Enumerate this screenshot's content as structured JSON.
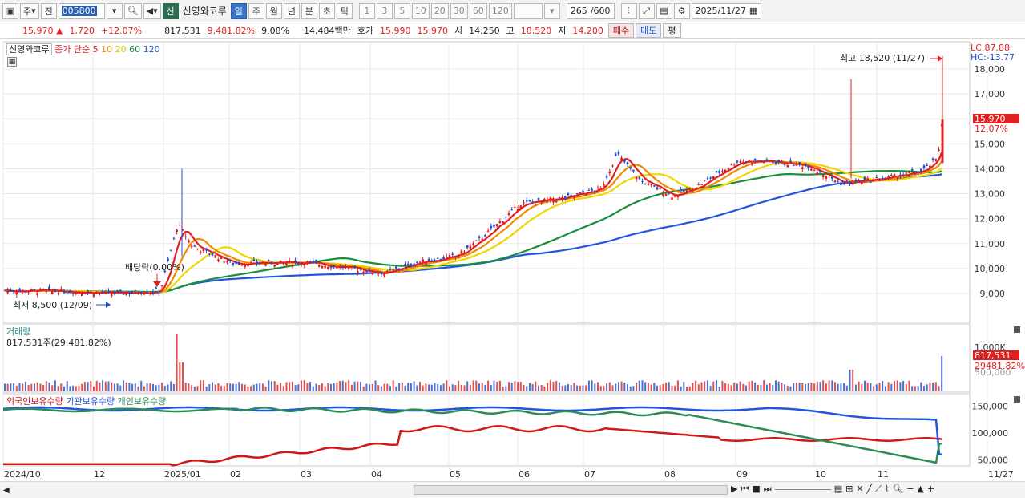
{
  "toolbar": {
    "market": "주",
    "prev_label": "전",
    "code": "005800",
    "stock_badge": "신",
    "stock_name": "신영와코루",
    "periods": [
      "일",
      "주",
      "월",
      "년",
      "분",
      "초",
      "틱"
    ],
    "active_period": "일",
    "intervals": [
      "1",
      "3",
      "5",
      "10",
      "20",
      "30",
      "60",
      "120"
    ],
    "count_display": "265",
    "count_total": "/600",
    "date": "2025/11/27"
  },
  "info": {
    "price": "15,970",
    "change": "1,720",
    "change_pct": "+12.07%",
    "volume": "817,531",
    "volume_ratio": "9,481.82%",
    "turnover": "9.08%",
    "amount": "14,484백만",
    "hoga_label": "호가",
    "ask": "15,990",
    "bid": "15,970",
    "open_label": "시",
    "open": "14,250",
    "high_label": "고",
    "high": "18,520",
    "low_label": "저",
    "low": "14,200",
    "buy_label": "매수",
    "sell_label": "매도",
    "eval_label": "평"
  },
  "price_panel": {
    "stock_name": "신영와코루",
    "ma_label": "종가 단순",
    "ma_periods": [
      {
        "label": "5",
        "color": "#e02020"
      },
      {
        "label": "10",
        "color": "#f08a00"
      },
      {
        "label": "20",
        "color": "#f2d500"
      },
      {
        "label": "60",
        "color": "#1a8f3a"
      },
      {
        "label": "120",
        "color": "#2255dd"
      }
    ],
    "lc": "LC:87.88",
    "hc": "HC:-13.77",
    "high_note": "최고 18,520 (11/27)",
    "low_note": "최저 8,500 (12/09)",
    "dividend_note": "배당락(0.00%)",
    "current_price_tag": "15,970",
    "current_pct_tag": "12.07%",
    "y_ticks": [
      "18,000",
      "17,000",
      "16,000",
      "15,000",
      "14,000",
      "13,000",
      "12,000",
      "11,000",
      "10,000",
      "9,000"
    ]
  },
  "volume_panel": {
    "title": "거래량",
    "value_note": "817,531주(29,481.82%)",
    "y_tick_top": "1,000K",
    "y_tick_mid": "500,000",
    "current_tag": "817,531",
    "ratio_tag": "29481.82%"
  },
  "holdings_panel": {
    "legend": [
      {
        "label": "외국인보유수량",
        "color": "#d01818"
      },
      {
        "label": "기관보유수량",
        "color": "#2255dd"
      },
      {
        "label": "개인보유수량",
        "color": "#2e8b57"
      }
    ],
    "y_ticks": [
      "150,000",
      "100,000",
      "50,000"
    ]
  },
  "x_axis": [
    "2024/10",
    "12",
    "2025/01",
    "02",
    "03",
    "04",
    "05",
    "06",
    "07",
    "08",
    "09",
    "10",
    "11",
    "11/27"
  ],
  "colors": {
    "up": "#e02020",
    "down": "#1f4fd1",
    "accent": "#2a5fb0"
  }
}
